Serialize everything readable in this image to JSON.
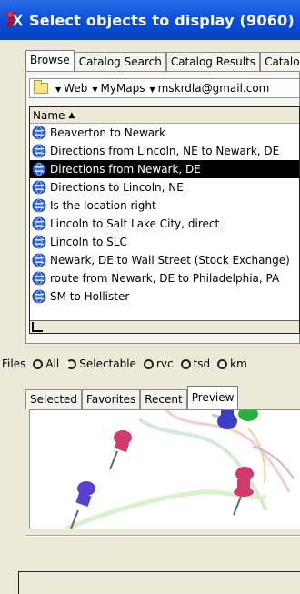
{
  "window": {
    "title": "Select objects to display (9060)"
  },
  "tabs_top": [
    {
      "label": "Browse",
      "active": true
    },
    {
      "label": "Catalog Search",
      "active": false
    },
    {
      "label": "Catalog Results",
      "active": false
    },
    {
      "label": "Catalo",
      "active": false
    }
  ],
  "path": {
    "crumbs": [
      "Web",
      "MyMaps",
      "mskrdla@gmail.com"
    ]
  },
  "list": {
    "header": "Name",
    "items": [
      {
        "label": "Beaverton to Newark",
        "selected": false
      },
      {
        "label": "Directions from Lincoln, NE to Newark, DE",
        "selected": false
      },
      {
        "label": "Directions from Newark, DE",
        "selected": true
      },
      {
        "label": "Directions to Lincoln, NE",
        "selected": false
      },
      {
        "label": "Is the location right",
        "selected": false
      },
      {
        "label": "Lincoln to Salt Lake City, direct",
        "selected": false
      },
      {
        "label": "Lincoln to SLC",
        "selected": false
      },
      {
        "label": "Newark, DE to Wall Street (Stock Exchange)",
        "selected": false
      },
      {
        "label": "route from Newark, DE to Philadelphia, PA",
        "selected": false
      },
      {
        "label": "SM to Hollister",
        "selected": false
      }
    ]
  },
  "files": {
    "label": "Files",
    "options": [
      {
        "label": "All",
        "checked": false
      },
      {
        "label": "Selectable",
        "checked": true
      },
      {
        "label": "rvc",
        "checked": false
      },
      {
        "label": "tsd",
        "checked": false
      },
      {
        "label": "km",
        "checked": false
      }
    ]
  },
  "tabs_bottom": [
    {
      "label": "Selected",
      "active": false
    },
    {
      "label": "Favorites",
      "active": false
    },
    {
      "label": "Recent",
      "active": false
    },
    {
      "label": "Preview",
      "active": true
    }
  ],
  "colors": {
    "titlebar": "#0a4cd8",
    "selection": "#000000",
    "pin_red": "#d23a6e",
    "pin_blue": "#5a3fd0",
    "pin_green": "#22b33a"
  }
}
